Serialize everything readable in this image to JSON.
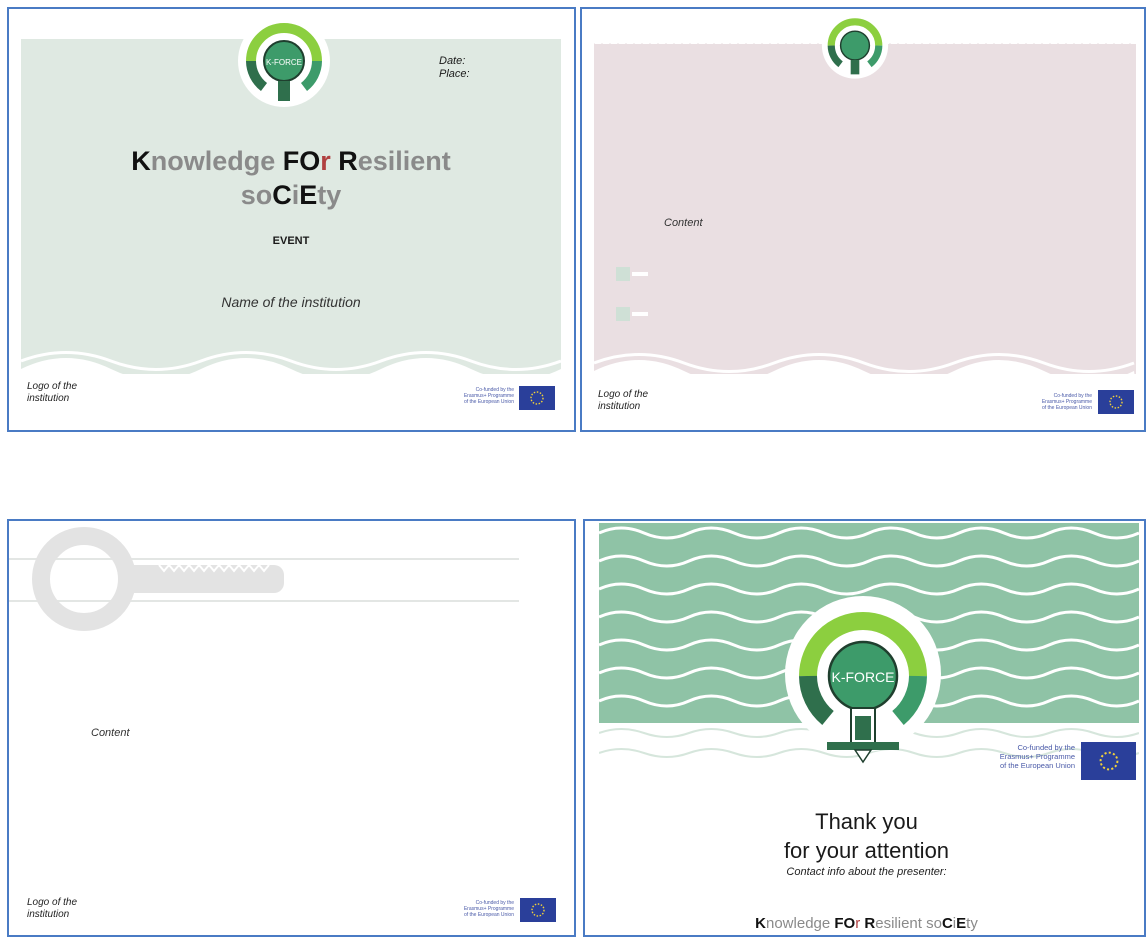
{
  "colors": {
    "border": "#4a7bc4",
    "mint_bg": "#dfe9e2",
    "pink_bg": "#eadfe2",
    "wave_green": "#8fc3a6",
    "logo_dark": "#2f6f4c",
    "logo_mid": "#3d9b6a",
    "logo_light": "#8ccf3f",
    "eu_blue": "#2a3f9a"
  },
  "slide1": {
    "date_label": "Date:",
    "place_label": "Place:",
    "title_line1": [
      {
        "text": "K",
        "style": "hl"
      },
      {
        "text": "nowledge ",
        "style": "n"
      },
      {
        "text": "FO",
        "style": "hl"
      },
      {
        "text": "r ",
        "style": "red"
      },
      {
        "text": "R",
        "style": "hl"
      },
      {
        "text": "esilient",
        "style": "n"
      }
    ],
    "title_line2": [
      {
        "text": "so",
        "style": "n"
      },
      {
        "text": "C",
        "style": "hl"
      },
      {
        "text": "i",
        "style": "n"
      },
      {
        "text": "E",
        "style": "hl"
      },
      {
        "text": "ty",
        "style": "n"
      }
    ],
    "event_label": "EVENT",
    "institution_name": "Name of the institution",
    "logo_line1": "Logo of the",
    "logo_line2": "institution",
    "cofund": [
      "Co-funded by the",
      "Erasmus+ Programme",
      "of the European Union"
    ]
  },
  "slide2": {
    "content_label": "Content",
    "logo_line1": "Logo of the",
    "logo_line2": "institution",
    "cofund": [
      "Co-funded by the",
      "Erasmus+ Programme",
      "of the European Union"
    ]
  },
  "slide3": {
    "content_label": "Content",
    "logo_line1": "Logo of the",
    "logo_line2": "institution",
    "cofund": [
      "Co-funded by the",
      "Erasmus+ Programme",
      "of the European Union"
    ]
  },
  "slide4": {
    "logo_text": "K-FORCE",
    "cofund": [
      "Co-funded by the",
      "Erasmus+ Programme",
      "of the European Union"
    ],
    "thank_you_line1": "Thank you",
    "thank_you_line2": "for your attention",
    "contact_info": "Contact info about the presenter:",
    "footer_title": [
      {
        "text": "K",
        "style": "hl"
      },
      {
        "text": "nowledge ",
        "style": "n"
      },
      {
        "text": "FO",
        "style": "hl"
      },
      {
        "text": "r ",
        "style": "red"
      },
      {
        "text": "R",
        "style": "hl"
      },
      {
        "text": "esilient ",
        "style": "n"
      },
      {
        "text": "so",
        "style": "n"
      },
      {
        "text": "C",
        "style": "hl"
      },
      {
        "text": "i",
        "style": "n"
      },
      {
        "text": "E",
        "style": "hl"
      },
      {
        "text": "ty",
        "style": "n"
      }
    ]
  }
}
